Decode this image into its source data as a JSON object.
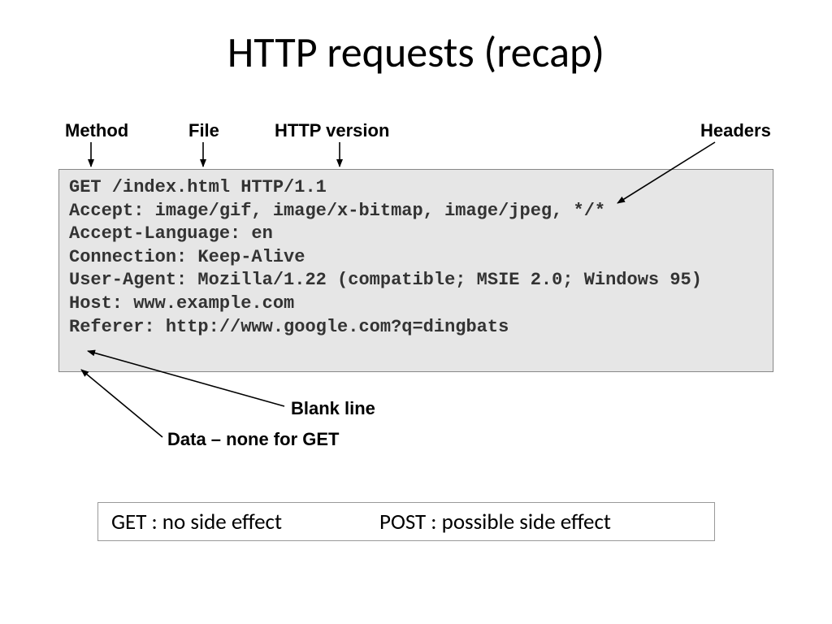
{
  "title": "HTTP requests (recap)",
  "labels": {
    "method": "Method",
    "file": "File",
    "http_version": "HTTP version",
    "headers": "Headers",
    "blank_line": "Blank line",
    "data_none": "Data – none for GET"
  },
  "code": {
    "line1": "GET /index.html HTTP/1.1",
    "line2": "Accept: image/gif, image/x-bitmap, image/jpeg, */*",
    "line3": "Accept-Language: en",
    "line4": "Connection: Keep-Alive",
    "line5": "User-Agent: Mozilla/1.22 (compatible; MSIE 2.0; Windows 95)",
    "line6": "Host: www.example.com",
    "line7": "Referer: http://www.google.com?q=dingbats"
  },
  "bottom": {
    "get": "GET :   no side effect",
    "post": "POST :   possible side effect"
  }
}
